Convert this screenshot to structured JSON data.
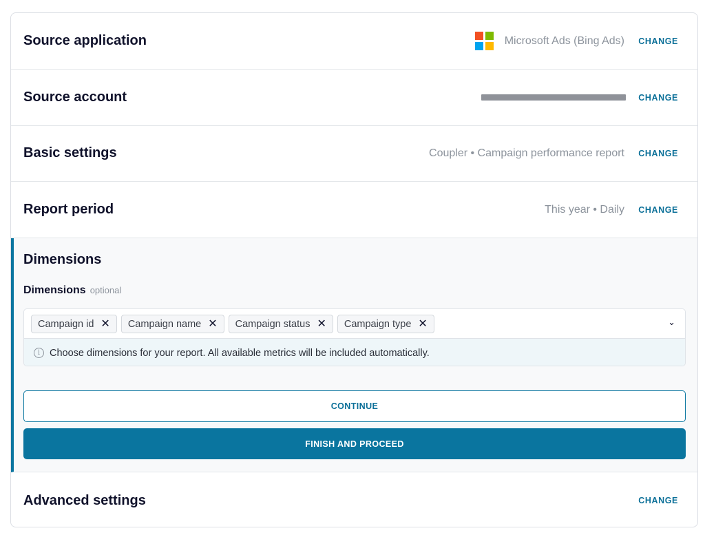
{
  "rows": {
    "source_app": {
      "title": "Source application",
      "value": "Microsoft Ads (Bing Ads)",
      "icon": "microsoft-logo-icon",
      "change": "CHANGE"
    },
    "source_account": {
      "title": "Source account",
      "change": "CHANGE"
    },
    "basic_settings": {
      "title": "Basic settings",
      "value": "Coupler • Campaign performance report",
      "change": "CHANGE"
    },
    "report_period": {
      "title": "Report period",
      "value": "This year • Daily",
      "change": "CHANGE"
    },
    "advanced_settings": {
      "title": "Advanced settings",
      "change": "CHANGE"
    }
  },
  "dimensions": {
    "title": "Dimensions",
    "field_label": "Dimensions",
    "optional": "optional",
    "chips": [
      {
        "label": "Campaign id"
      },
      {
        "label": "Campaign name"
      },
      {
        "label": "Campaign status"
      },
      {
        "label": "Campaign type"
      }
    ],
    "hint": "Choose dimensions for your report. All available metrics will be included automatically.",
    "continue_label": "CONTINUE",
    "finish_label": "FINISH AND PROCEED"
  },
  "colors": {
    "accent": "#0a759f",
    "ms_red": "#f25022",
    "ms_green": "#7fba00",
    "ms_blue": "#00a4ef",
    "ms_yellow": "#ffb900"
  }
}
